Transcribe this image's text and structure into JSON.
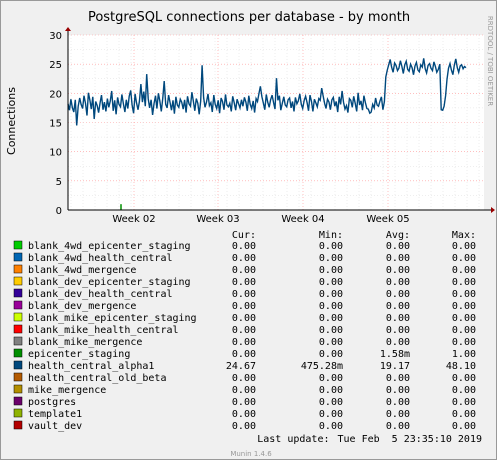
{
  "chart_data": {
    "type": "line",
    "title": "PostgreSQL connections per database - by month",
    "ylabel": "Connections",
    "side_label": "RRDTOOL / TOBI OETIKER",
    "ylim": [
      0,
      30
    ],
    "yticks": [
      "0",
      "5",
      "10",
      "15",
      "20",
      "25",
      "30"
    ],
    "xticks": [
      "Week 02",
      "Week 03",
      "Week 04",
      "Week 05"
    ],
    "grid": true,
    "legend_headers": {
      "cur": "Cur:",
      "min": "Min:",
      "avg": "Avg:",
      "max": "Max:"
    },
    "series": [
      {
        "name": "blank_4wd_epicenter_staging",
        "color": "#00cc00",
        "cur": "0.00",
        "min": "0.00",
        "avg": "0.00",
        "max": "0.00"
      },
      {
        "name": "blank_4wd_health_central",
        "color": "#0066b3",
        "cur": "0.00",
        "min": "0.00",
        "avg": "0.00",
        "max": "0.00"
      },
      {
        "name": "blank_4wd_mergence",
        "color": "#ff8000",
        "cur": "0.00",
        "min": "0.00",
        "avg": "0.00",
        "max": "0.00"
      },
      {
        "name": "blank_dev_epicenter_staging",
        "color": "#ffcc00",
        "cur": "0.00",
        "min": "0.00",
        "avg": "0.00",
        "max": "0.00"
      },
      {
        "name": "blank_dev_health_central",
        "color": "#330099",
        "cur": "0.00",
        "min": "0.00",
        "avg": "0.00",
        "max": "0.00"
      },
      {
        "name": "blank_dev_mergence",
        "color": "#990099",
        "cur": "0.00",
        "min": "0.00",
        "avg": "0.00",
        "max": "0.00"
      },
      {
        "name": "blank_mike_epicenter_staging",
        "color": "#ccff00",
        "cur": "0.00",
        "min": "0.00",
        "avg": "0.00",
        "max": "0.00"
      },
      {
        "name": "blank_mike_health_central",
        "color": "#ff0000",
        "cur": "0.00",
        "min": "0.00",
        "avg": "0.00",
        "max": "0.00"
      },
      {
        "name": "blank_mike_mergence",
        "color": "#808080",
        "cur": "0.00",
        "min": "0.00",
        "avg": "0.00",
        "max": "0.00"
      },
      {
        "name": "epicenter_staging",
        "color": "#008f00",
        "cur": "0.00",
        "min": "0.00",
        "avg": "1.58m",
        "max": "1.00"
      },
      {
        "name": "health_central_alpha1",
        "color": "#00487d",
        "cur": "24.67",
        "min": "475.28m",
        "avg": "19.17",
        "max": "48.10"
      },
      {
        "name": "health_central_old_beta",
        "color": "#b35a00",
        "cur": "0.00",
        "min": "0.00",
        "avg": "0.00",
        "max": "0.00"
      },
      {
        "name": "mike_mergence",
        "color": "#b38f00",
        "cur": "0.00",
        "min": "0.00",
        "avg": "0.00",
        "max": "0.00"
      },
      {
        "name": "postgres",
        "color": "#6b006b",
        "cur": "0.00",
        "min": "0.00",
        "avg": "0.00",
        "max": "0.00"
      },
      {
        "name": "template1",
        "color": "#8fb300",
        "cur": "0.00",
        "min": "0.00",
        "avg": "0.00",
        "max": "0.00"
      },
      {
        "name": "vault_dev",
        "color": "#b30000",
        "cur": "0.00",
        "min": "0.00",
        "avg": "0.00",
        "max": "0.00"
      }
    ],
    "health_central_alpha1_values": [
      18.2,
      17.1,
      19.0,
      17.5,
      16.8,
      18.9,
      14.5,
      17.8,
      19.2,
      18.1,
      17.4,
      19.6,
      18.3,
      16.2,
      20.1,
      18.8,
      17.3,
      19.4,
      15.6,
      18.6,
      17.9,
      16.7,
      18.4,
      19.7,
      17.2,
      18.5,
      16.9,
      19.1,
      17.6,
      18.7,
      20.4,
      17.0,
      18.8,
      16.4,
      19.3,
      18.1,
      17.7,
      19.8,
      18.2,
      16.8,
      18.9,
      17.4,
      19.5,
      20.5,
      18.0,
      16.6,
      19.9,
      18.4,
      17.2,
      18.6,
      21.6,
      18.5,
      20.3,
      17.8,
      23.3,
      19.1,
      17.5,
      18.9,
      16.3,
      18.2,
      19.6,
      17.4,
      20.0,
      18.7,
      16.9,
      19.2,
      22.1,
      18.1,
      17.5,
      19.7,
      18.4,
      17.1,
      18.8,
      16.5,
      19.4,
      18.0,
      17.6,
      19.0,
      18.5,
      17.3,
      18.9,
      16.7,
      19.5,
      18.2,
      17.8,
      20.2,
      18.6,
      17.0,
      19.1,
      18.3,
      16.4,
      18.7,
      24.8,
      19.3,
      17.6,
      18.5,
      19.9,
      17.9,
      18.4,
      16.8,
      19.7,
      18.1,
      17.4,
      18.8,
      16.6,
      19.2,
      18.6,
      17.2,
      19.8,
      18.0,
      17.7,
      18.3,
      16.9,
      19.5,
      18.4,
      17.1,
      19.0,
      18.2,
      17.5,
      18.9,
      17.8,
      19.3,
      18.5,
      17.0,
      19.6,
      18.1,
      17.4,
      18.7,
      16.7,
      19.1,
      18.6,
      20.0,
      21.2,
      19.4,
      18.3,
      17.2,
      19.8,
      18.5,
      17.6,
      18.9,
      19.7,
      18.4,
      17.3,
      22.6,
      18.8,
      19.6,
      17.1,
      18.3,
      19.4,
      18.0,
      17.7,
      18.9,
      19.2,
      17.5,
      18.6,
      16.9,
      19.3,
      18.2,
      18.7,
      19.9,
      18.1,
      17.4,
      18.8,
      19.5,
      18.4,
      17.0,
      19.7,
      18.6,
      16.9,
      19.0,
      18.4,
      17.7,
      19.1,
      18.8,
      20.9,
      19.6,
      18.3,
      17.4,
      19.0,
      18.5,
      17.2,
      18.9,
      19.3,
      17.8,
      18.6,
      16.8,
      19.4,
      18.1,
      20.4,
      18.5,
      17.3,
      17.9,
      16.7,
      19.1,
      18.8,
      17.6,
      19.5,
      18.3,
      16.9,
      20.1,
      18.0,
      18.7,
      17.1,
      19.6,
      18.4,
      17.4,
      17.3,
      16.6,
      16.8,
      18.1,
      17.5,
      19.2,
      18.0,
      17.8,
      18.7,
      19.4,
      17.2,
      18.6,
      22.8,
      24.0,
      24.9,
      25.8,
      24.5,
      23.6,
      25.2,
      24.8,
      23.9,
      24.3,
      25.6,
      24.6,
      23.4,
      24.9,
      25.5,
      24.1,
      23.8,
      25.0,
      24.4,
      23.2,
      24.7,
      25.3,
      24.0,
      23.7,
      24.9,
      24.5,
      26.0,
      24.2,
      23.5,
      24.8,
      25.1,
      24.3,
      23.9,
      25.4,
      24.6,
      23.6,
      24.1,
      25.0,
      17.2,
      17.1,
      17.8,
      19.6,
      22.4,
      24.3,
      25.1,
      24.0,
      23.2,
      24.8,
      25.9,
      24.4,
      23.6,
      24.7,
      24.9,
      24.2,
      24.6,
      24.4
    ]
  },
  "footer": {
    "last_update_label": "Last update:",
    "last_update_value": "Tue Feb  5 23:35:10 2019",
    "munin_version": "Munin 1.4.6"
  }
}
